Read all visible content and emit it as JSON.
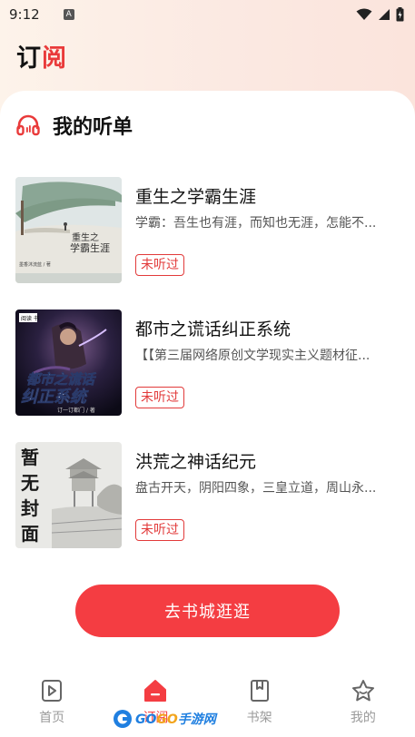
{
  "status_bar": {
    "time": "9:12",
    "notification": "A"
  },
  "app": {
    "title_part1": "订",
    "title_part2": "阅"
  },
  "section": {
    "title": "我的听单",
    "icon": "headphones-icon"
  },
  "books": [
    {
      "title": "重生之学霸生涯",
      "desc": "学霸：吾生也有涯，而知也无涯，怎能不...",
      "status": "未听过",
      "cover_title": "重生之学霸生涯",
      "cover_author": "墨香沐流蓝 / 著"
    },
    {
      "title": "都市之谎话纠正系统",
      "desc": "【【第三届网络原创文学现实主义题材征...",
      "status": "未听过",
      "cover_title_1": "都市之谎话",
      "cover_title_2": "纠正系统",
      "cover_author": "订一订都门 / 著",
      "cover_badge": "阅读 书"
    },
    {
      "title": "洪荒之神话纪元",
      "desc": "盘古开天，阴阳四象，三皇立道，周山永...",
      "status": "未听过",
      "cover_title": "暂无封面"
    }
  ],
  "cta": {
    "label": "去书城逛逛"
  },
  "tabs": [
    {
      "label": "首页",
      "icon": "home-icon"
    },
    {
      "label": "订阅",
      "icon": "subscribe-icon"
    },
    {
      "label": "书架",
      "icon": "bookshelf-icon"
    },
    {
      "label": "我的",
      "icon": "star-icon"
    }
  ],
  "watermark": {
    "text_a": "GO",
    "text_b": "GO",
    "text_c": "手游网"
  },
  "colors": {
    "accent": "#f43d42",
    "badge": "#e23a3a"
  }
}
